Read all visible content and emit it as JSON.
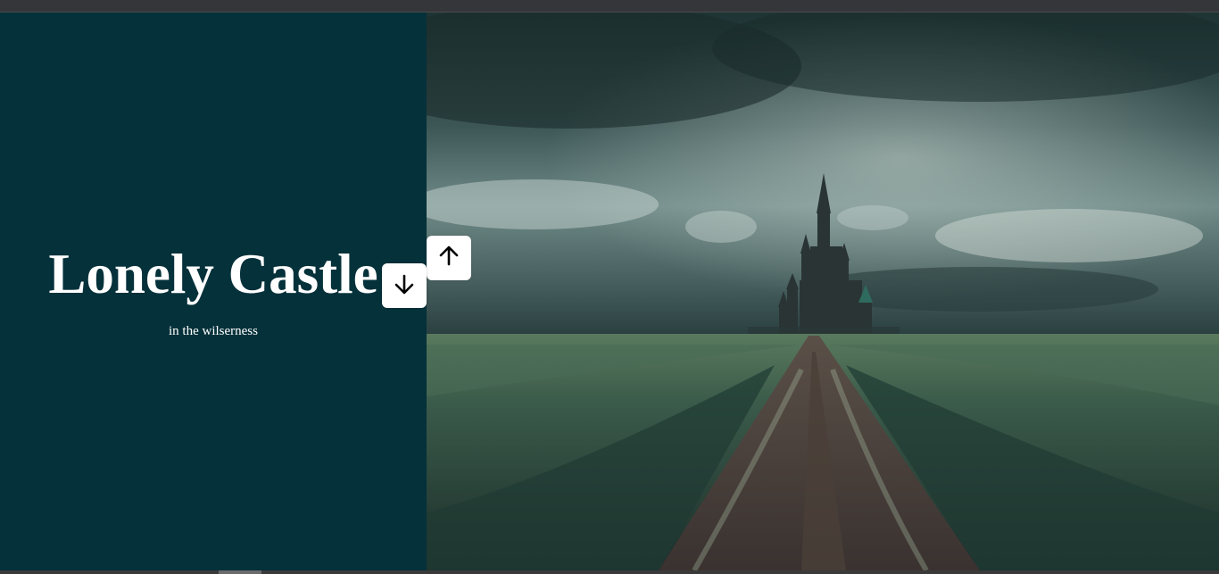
{
  "hero": {
    "title": "Lonely Castle",
    "subtitle": "in the wilserness"
  },
  "controls": {
    "up_icon": "arrow-up-icon",
    "down_icon": "arrow-down-icon"
  },
  "image": {
    "subject": "castle-landscape"
  },
  "colors": {
    "panel_background": "#05313a",
    "text": "#ffffff",
    "button_background": "#ffffff"
  }
}
